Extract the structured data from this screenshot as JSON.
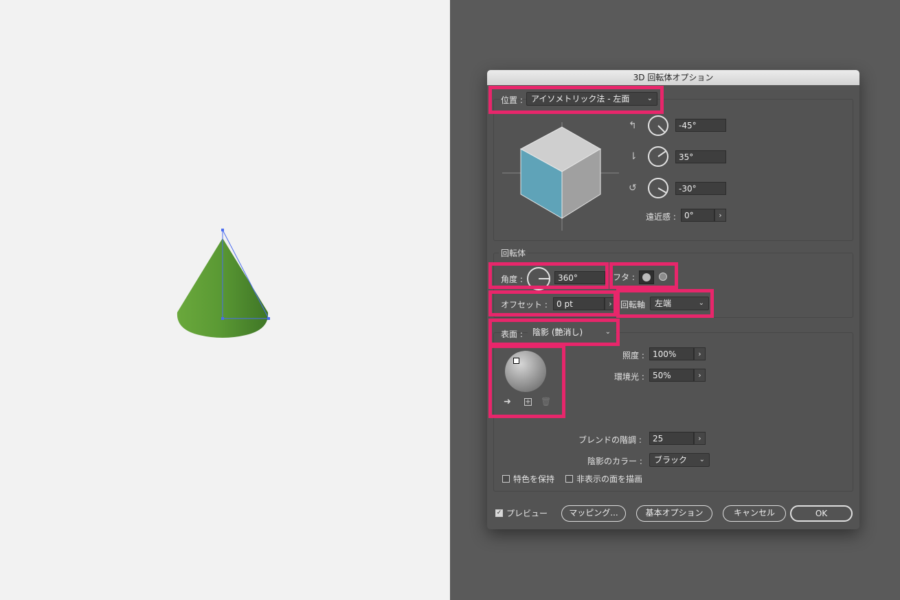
{
  "dialog": {
    "title": "3D 回転体オプション",
    "position": {
      "label": "位置 :",
      "value": "アイソメトリック法 - 左面",
      "rot_x": "-45°",
      "rot_y": "35°",
      "rot_z": "-30°",
      "perspective_label": "遠近感 :",
      "perspective": "0°"
    },
    "revolve": {
      "section": "回転体",
      "angle_label": "角度 :",
      "angle": "360°",
      "cap_label": "フタ :",
      "offset_label": "オフセット :",
      "offset": "0 pt",
      "axis_label": "回転軸",
      "axis_value": "左端"
    },
    "surface": {
      "label": "表面 :",
      "value": "陰影 (艶消し)",
      "intensity_label": "照度 :",
      "intensity": "100%",
      "ambient_label": "環境光 :",
      "ambient": "50%",
      "blend_label": "ブレンドの階調 :",
      "blend": "25",
      "shade_color_label": "陰影のカラー :",
      "shade_color": "ブラック",
      "preserve_spot": "特色を保持",
      "draw_hidden": "非表示の面を描画"
    },
    "footer": {
      "preview": "プレビュー",
      "preview_checked": true,
      "mapping": "マッピング...",
      "fewer_options": "基本オプション",
      "cancel": "キャンセル",
      "ok": "OK"
    }
  },
  "colors": {
    "highlight": "#e8266b",
    "cone": "#5b9a34",
    "cube_left": "#5fa3b8",
    "selection": "#4a6cf0"
  }
}
